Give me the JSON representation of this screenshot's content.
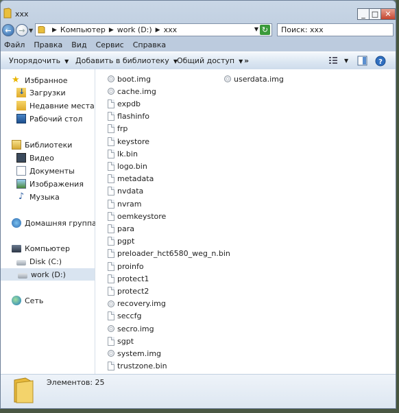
{
  "window": {
    "title": "xxx",
    "minimize": "_",
    "maximize": "□",
    "close": "✕"
  },
  "address": {
    "crumbs": [
      "Компьютер",
      "work (D:)",
      "xxx"
    ],
    "search_placeholder": "Поиск: xxx"
  },
  "menu": [
    "Файл",
    "Правка",
    "Вид",
    "Сервис",
    "Справка"
  ],
  "toolbar": {
    "organize": "Упорядочить",
    "add_library": "Добавить в библиотеку",
    "share": "Общий доступ",
    "more": "»"
  },
  "nav": {
    "favorites": "Избранное",
    "downloads": "Загрузки",
    "recent": "Недавние места",
    "desktop": "Рабочий стол",
    "libraries": "Библиотеки",
    "video": "Видео",
    "documents": "Документы",
    "images": "Изображения",
    "music": "Музыка",
    "homegroup": "Домашняя группа",
    "computer": "Компьютер",
    "disk_c": "Disk (C:)",
    "work_d": "work (D:)",
    "network": "Сеть"
  },
  "files_col1": [
    {
      "name": "boot.img",
      "icon": "disc-image-icon"
    },
    {
      "name": "cache.img",
      "icon": "disc-image-icon"
    },
    {
      "name": "expdb",
      "icon": "file-icon"
    },
    {
      "name": "flashinfo",
      "icon": "file-icon"
    },
    {
      "name": "frp",
      "icon": "file-icon"
    },
    {
      "name": "keystore",
      "icon": "file-icon"
    },
    {
      "name": "lk.bin",
      "icon": "file-icon"
    },
    {
      "name": "logo.bin",
      "icon": "file-icon"
    },
    {
      "name": "metadata",
      "icon": "file-icon"
    },
    {
      "name": "nvdata",
      "icon": "file-icon"
    },
    {
      "name": "nvram",
      "icon": "file-icon"
    },
    {
      "name": "oemkeystore",
      "icon": "file-icon"
    },
    {
      "name": "para",
      "icon": "file-icon"
    },
    {
      "name": "pgpt",
      "icon": "file-icon"
    },
    {
      "name": "preloader_hct6580_weg_n.bin",
      "icon": "file-icon"
    },
    {
      "name": "proinfo",
      "icon": "file-icon"
    },
    {
      "name": "protect1",
      "icon": "file-icon"
    },
    {
      "name": "protect2",
      "icon": "file-icon"
    },
    {
      "name": "recovery.img",
      "icon": "disc-image-icon"
    },
    {
      "name": "seccfg",
      "icon": "file-icon"
    },
    {
      "name": "secro.img",
      "icon": "disc-image-icon"
    },
    {
      "name": "sgpt",
      "icon": "file-icon"
    },
    {
      "name": "system.img",
      "icon": "disc-image-icon"
    },
    {
      "name": "trustzone.bin",
      "icon": "file-icon"
    }
  ],
  "files_col2": [
    {
      "name": "userdata.img",
      "icon": "disc-image-icon"
    }
  ],
  "status": {
    "count_text": "Элементов: 25"
  }
}
